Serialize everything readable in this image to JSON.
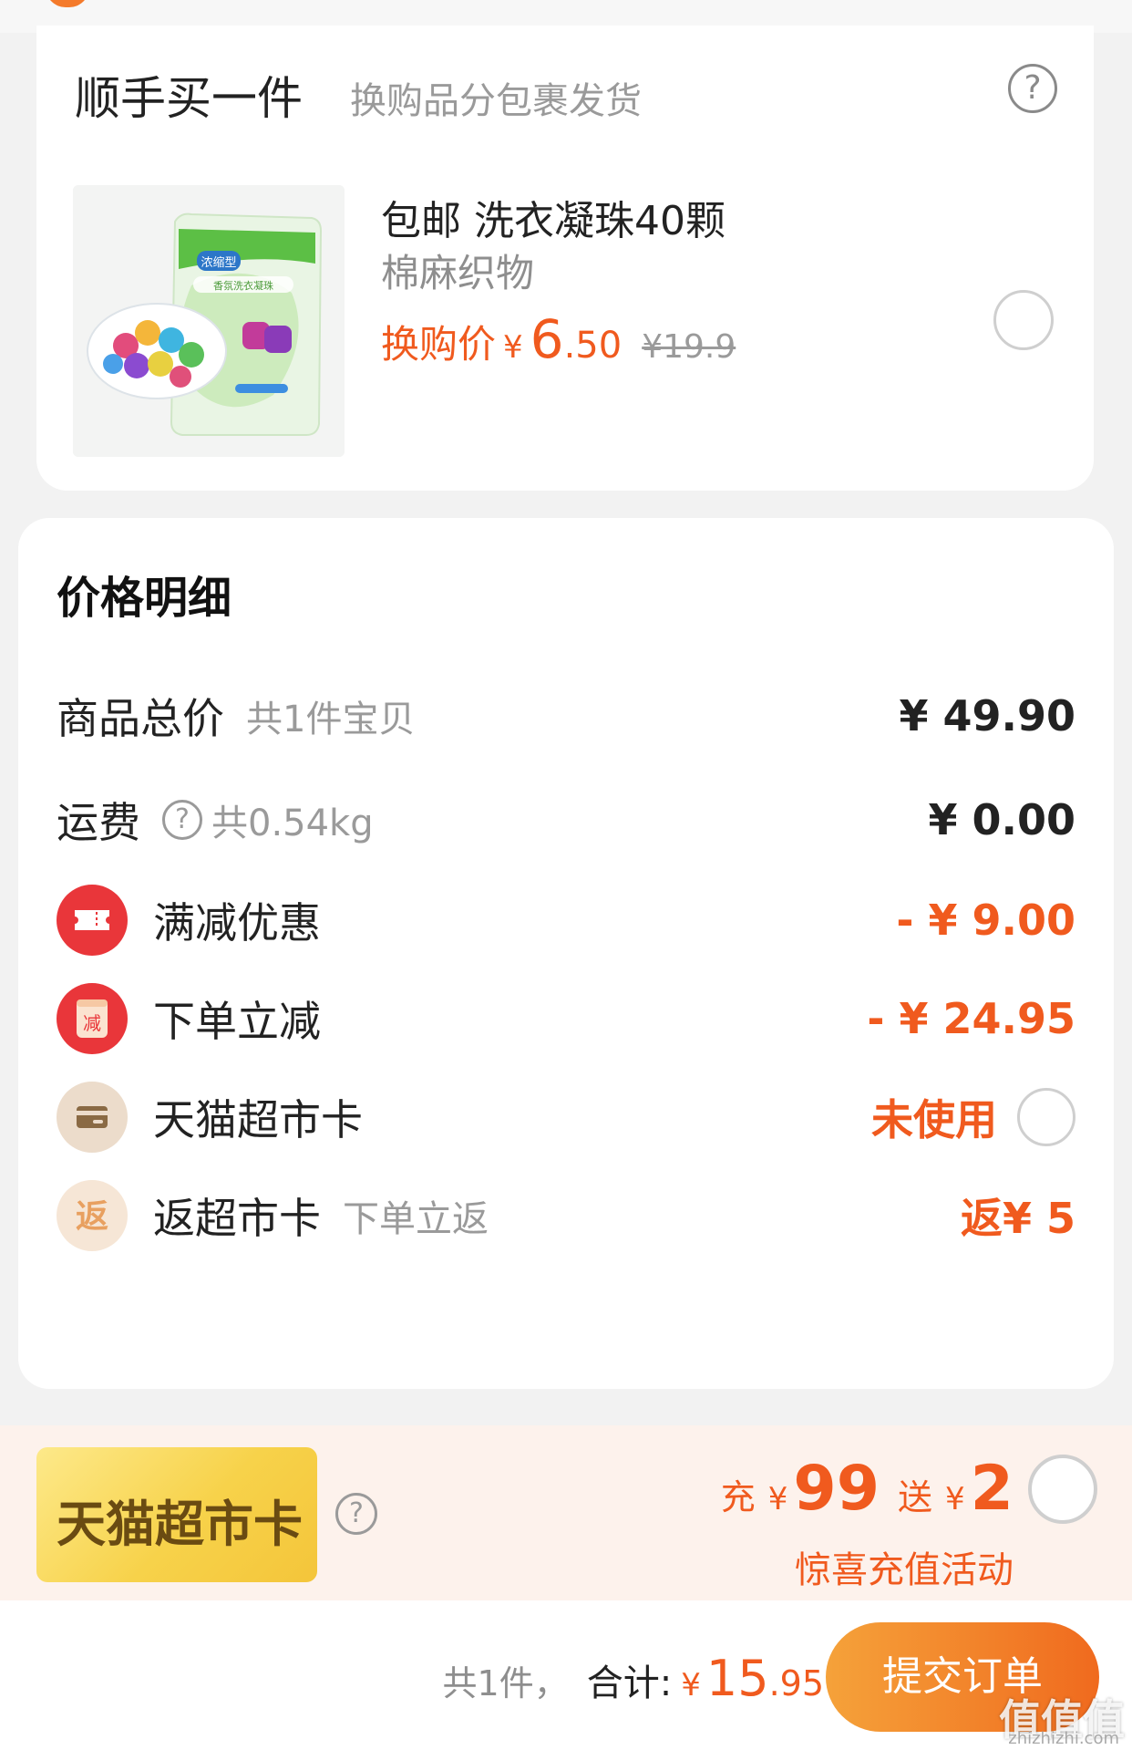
{
  "addon": {
    "title": "顺手买一件",
    "subtitle": "换购品分包裹发货",
    "help_glyph": "?",
    "product": {
      "name": "包邮 洗衣凝珠40颗",
      "spec": "棉麻织物",
      "price_label": "换购价",
      "currency": "¥",
      "price_int": "6",
      "price_dec": ".50",
      "original_price": "¥19.9",
      "image_text": [
        "浓缩型",
        "香氛洗衣凝珠"
      ]
    }
  },
  "price_detail": {
    "title": "价格明细",
    "rows": [
      {
        "label": "商品总价",
        "sub": "共1件宝贝",
        "value": "¥ 49.90"
      },
      {
        "label": "运费",
        "sub": "共0.54kg",
        "value": "¥ 0.00",
        "help_glyph": "?"
      },
      {
        "label": "满减优惠",
        "value": "- ¥ 9.00",
        "icon": "coupon-ticket-icon"
      },
      {
        "label": "下单立减",
        "value": "- ¥ 24.95",
        "icon": "instant-discount-icon",
        "icon_text": "减"
      },
      {
        "label": "天猫超市卡",
        "value": "未使用",
        "icon": "wallet-card-icon"
      },
      {
        "label": "返超市卡",
        "sub": "下单立返",
        "value": "返¥ 5",
        "icon": "cashback-icon",
        "icon_text": "返"
      }
    ]
  },
  "promo": {
    "card_label": "天猫超市卡",
    "help_glyph": "?",
    "charge_word": "充",
    "charge_amount": "99",
    "gift_word": "送",
    "gift_amount": "2",
    "currency": "¥",
    "activity": "惊喜充值活动"
  },
  "footer": {
    "count": "共1件，",
    "total_label": "合计:",
    "currency": "¥",
    "total_int": "15",
    "total_dec": ".95",
    "submit": "提交订单"
  },
  "watermark": {
    "main": "值值值",
    "sub": "zhizhizhi.com"
  },
  "colors": {
    "accent": "#f05a1e",
    "red_icon": "#e9363a",
    "promo_bg": "#fdf2ec",
    "gold": "#f7d24a"
  }
}
